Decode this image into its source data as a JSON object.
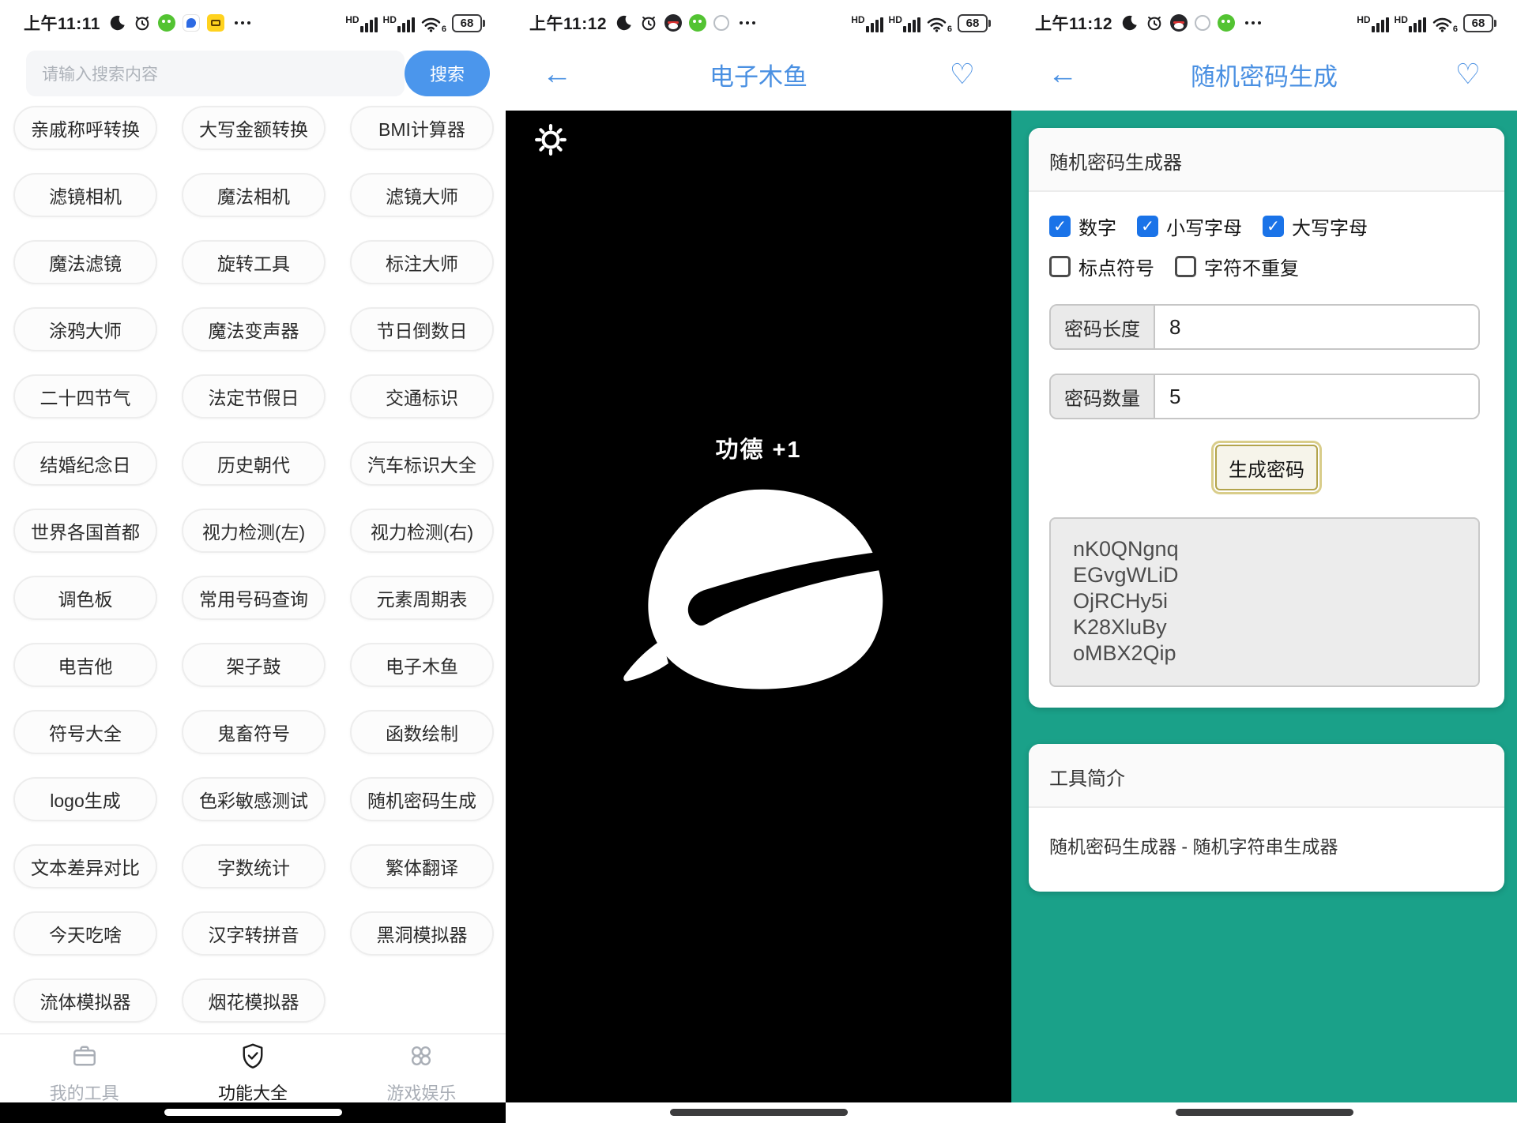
{
  "colors": {
    "accent_blue": "#4a90e2",
    "search_button_blue": "#4b96ec",
    "teal_background": "#1aa189",
    "checkbox_blue": "#1a73e8",
    "wooden_fish_bg": "#000000"
  },
  "left_panel": {
    "status_bar": {
      "time": "上午11:11",
      "hd_label": "HD",
      "wifi_label": "6",
      "battery_percent": "68"
    },
    "search": {
      "placeholder": "请输入搜索内容",
      "button_label": "搜索"
    },
    "tool_buttons": [
      "亲戚称呼转换",
      "大写金额转换",
      "BMI计算器",
      "滤镜相机",
      "魔法相机",
      "滤镜大师",
      "魔法滤镜",
      "旋转工具",
      "标注大师",
      "涂鸦大师",
      "魔法变声器",
      "节日倒数日",
      "二十四节气",
      "法定节假日",
      "交通标识",
      "结婚纪念日",
      "历史朝代",
      "汽车标识大全",
      "世界各国首都",
      "视力检测(左)",
      "视力检测(右)",
      "调色板",
      "常用号码查询",
      "元素周期表",
      "电吉他",
      "架子鼓",
      "电子木鱼",
      "符号大全",
      "鬼畜符号",
      "函数绘制",
      "logo生成",
      "色彩敏感测试",
      "随机密码生成",
      "文本差异对比",
      "字数统计",
      "繁体翻译",
      "今天吃啥",
      "汉字转拼音",
      "黑洞模拟器",
      "流体模拟器",
      "烟花模拟器"
    ],
    "bottom_nav": {
      "items": [
        {
          "label": "我的工具",
          "icon": "briefcase-icon",
          "active": false
        },
        {
          "label": "功能大全",
          "icon": "shield-check-icon",
          "active": true
        },
        {
          "label": "游戏娱乐",
          "icon": "clover-icon",
          "active": false
        }
      ]
    }
  },
  "middle_panel": {
    "status_bar": {
      "time": "上午11:12",
      "hd_label": "HD",
      "wifi_label": "6",
      "battery_percent": "68"
    },
    "header": {
      "back_glyph": "←",
      "title": "电子木鱼",
      "favorite_glyph": "♡"
    },
    "merit_toast": "功德 +1"
  },
  "right_panel": {
    "status_bar": {
      "time": "上午11:12",
      "hd_label": "HD",
      "wifi_label": "6",
      "battery_percent": "68"
    },
    "header": {
      "back_glyph": "←",
      "title": "随机密码生成",
      "favorite_glyph": "♡"
    },
    "generator_card": {
      "title": "随机密码生成器",
      "options": [
        {
          "label": "数字",
          "checked": true
        },
        {
          "label": "小写字母",
          "checked": true
        },
        {
          "label": "大写字母",
          "checked": true
        },
        {
          "label": "标点符号",
          "checked": false
        },
        {
          "label": "字符不重复",
          "checked": false
        }
      ],
      "fields": [
        {
          "label": "密码长度",
          "value": "8"
        },
        {
          "label": "密码数量",
          "value": "5"
        }
      ],
      "generate_button_label": "生成密码",
      "generated_passwords": [
        "nK0QNgnq",
        "EGvgWLiD",
        "OjRCHy5i",
        "K28XluBy",
        "oMBX2Qip"
      ]
    },
    "intro_card": {
      "title": "工具简介",
      "body": "随机密码生成器 - 随机字符串生成器"
    }
  }
}
